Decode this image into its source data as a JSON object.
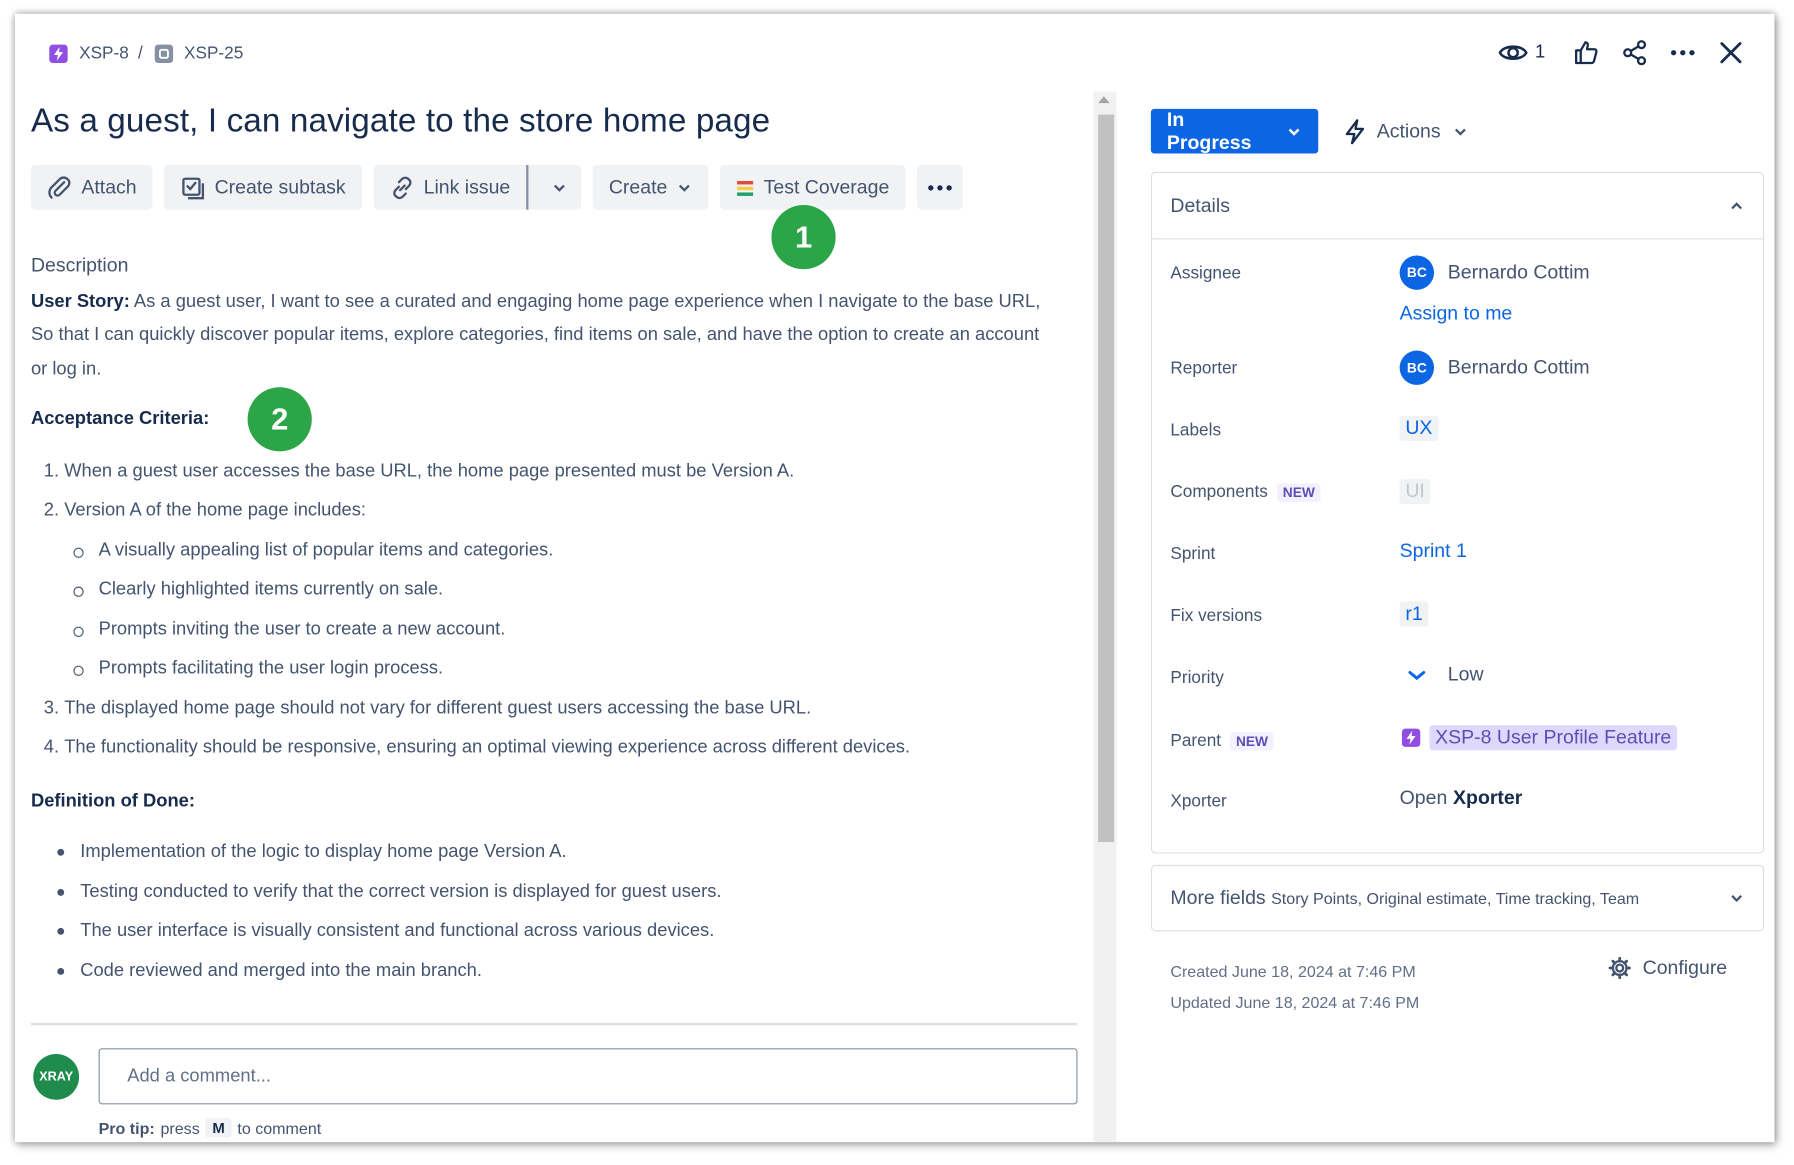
{
  "breadcrumb": {
    "parent_key": "XSP-8",
    "separator": "/",
    "issue_key": "XSP-25"
  },
  "header_actions": {
    "watch_count": "1"
  },
  "issue": {
    "title": "As a guest, I can navigate to the store home page"
  },
  "toolbar": {
    "attach": "Attach",
    "create_subtask": "Create subtask",
    "link_issue": "Link issue",
    "create": "Create",
    "test_coverage": "Test Coverage"
  },
  "callouts": {
    "one": "1",
    "two": "2"
  },
  "description": {
    "heading": "Description",
    "user_story_label": "User Story:",
    "user_story_text": " As a guest user, I want to see a curated and engaging home page experience when I navigate to the base URL, So that I can quickly discover popular items, explore categories, find items on sale, and have the option to create an account or log in.",
    "acceptance_heading": "Acceptance Criteria:",
    "criteria": [
      "When a guest user accesses the base URL, the home page presented must be Version A.",
      "Version A of the home page includes:",
      "The displayed home page should not vary for different guest users accessing the base URL.",
      "The functionality should be responsive, ensuring an optimal viewing experience across different devices."
    ],
    "criteria_sub": [
      "A visually appealing list of popular items and categories.",
      "Clearly highlighted items currently on sale.",
      "Prompts inviting the user to create a new account.",
      "Prompts facilitating the user login process."
    ],
    "dod_heading": "Definition of Done:",
    "dod": [
      "Implementation of the logic to display home page Version A.",
      "Testing conducted to verify that the correct version is displayed for guest users.",
      "The user interface is visually consistent and functional across various devices.",
      "Code reviewed and merged into the main branch."
    ]
  },
  "comment": {
    "avatar": "XRAY",
    "placeholder": "Add a comment...",
    "protip_label": "Pro tip:",
    "protip_press": "press",
    "protip_key": "M",
    "protip_suffix": "to comment"
  },
  "sidebar": {
    "status": "In Progress",
    "actions": "Actions",
    "details_title": "Details",
    "new_label": "NEW",
    "fields": {
      "assignee_label": "Assignee",
      "assignee_initials": "BC",
      "assignee_name": "Bernardo Cottim",
      "assign_to_me": "Assign to me",
      "reporter_label": "Reporter",
      "reporter_initials": "BC",
      "reporter_name": "Bernardo Cottim",
      "labels_label": "Labels",
      "labels_value": "UX",
      "components_label": "Components",
      "components_value": "UI",
      "sprint_label": "Sprint",
      "sprint_value": "Sprint 1",
      "fix_versions_label": "Fix versions",
      "fix_versions_value": "r1",
      "priority_label": "Priority",
      "priority_value": "Low",
      "parent_label": "Parent",
      "parent_value": "XSP-8 User Profile Feature",
      "xporter_label": "Xporter",
      "xporter_open": "Open",
      "xporter_name": "Xporter"
    },
    "more_fields_label": "More fields",
    "more_fields_hint": "Story Points, Original estimate, Time tracking, Team",
    "created": "Created June 18, 2024 at 7:46 PM",
    "updated": "Updated June 18, 2024 at 7:46 PM",
    "configure": "Configure"
  },
  "colors": {
    "primary": "#0c66e4",
    "callout": "#2ba548",
    "epic": "#904ee2",
    "text": "#172b4d"
  }
}
